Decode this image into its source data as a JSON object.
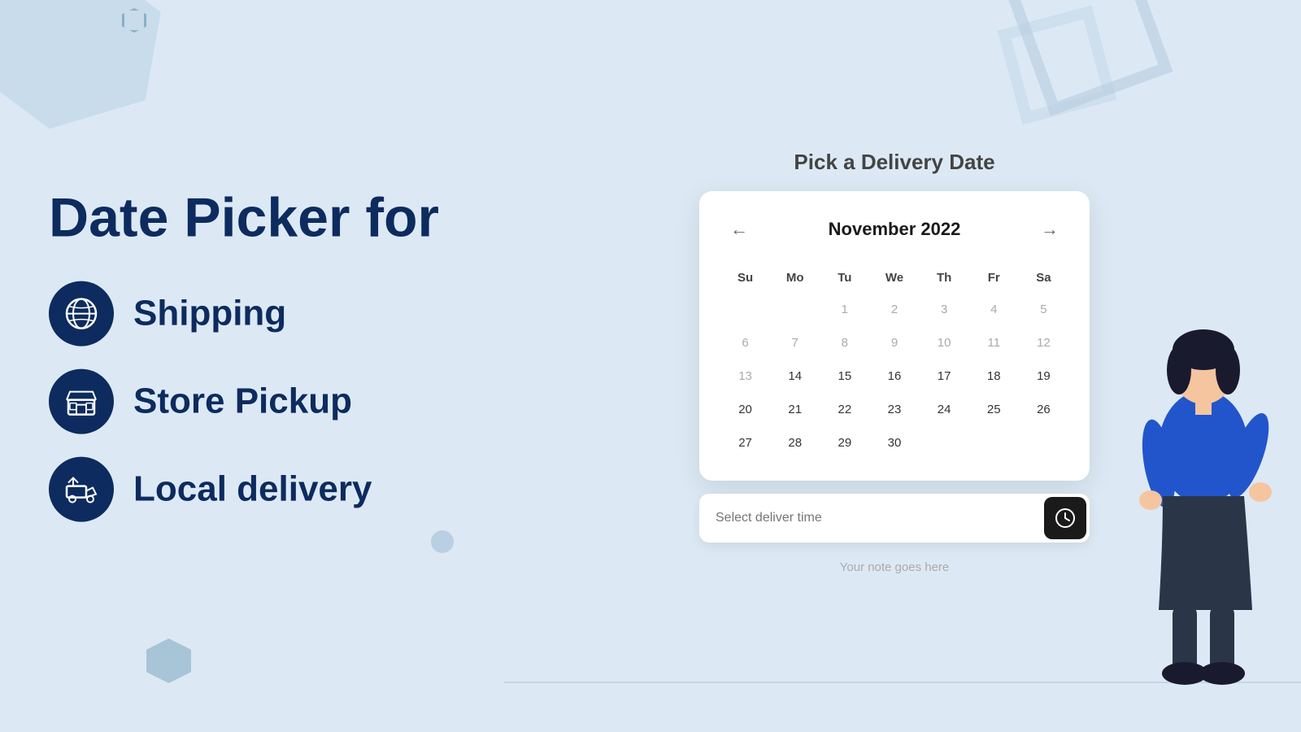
{
  "page": {
    "background_color": "#dce9f5"
  },
  "left": {
    "title": "Date Picker for",
    "features": [
      {
        "id": "shipping",
        "label": "Shipping",
        "icon": "🌐"
      },
      {
        "id": "store-pickup",
        "label": "Store Pickup",
        "icon": "🏪"
      },
      {
        "id": "local-delivery",
        "label": "Local delivery",
        "icon": "🚚"
      }
    ]
  },
  "calendar": {
    "title": "Pick a Delivery Date",
    "month_year": "November 2022",
    "prev_btn": "←",
    "next_btn": "→",
    "day_headers": [
      "Su",
      "Mo",
      "Tu",
      "We",
      "Th",
      "Fr",
      "Sa"
    ],
    "weeks": [
      [
        "",
        "",
        "1",
        "2",
        "3",
        "4",
        "5"
      ],
      [
        "6",
        "7",
        "8",
        "9",
        "10",
        "11",
        "12"
      ],
      [
        "13",
        "14",
        "15",
        "16",
        "17",
        "18",
        "19"
      ],
      [
        "20",
        "21",
        "22",
        "23",
        "24",
        "25",
        "26"
      ],
      [
        "27",
        "28",
        "29",
        "30",
        "",
        "",
        ""
      ]
    ],
    "unavailable_days": [
      "1",
      "2",
      "3",
      "4",
      "5",
      "6",
      "7",
      "8",
      "9",
      "10",
      "11",
      "12",
      "13"
    ],
    "time_placeholder": "Select deliver time",
    "time_icon": "🕐",
    "note_placeholder": "Your note goes here"
  }
}
